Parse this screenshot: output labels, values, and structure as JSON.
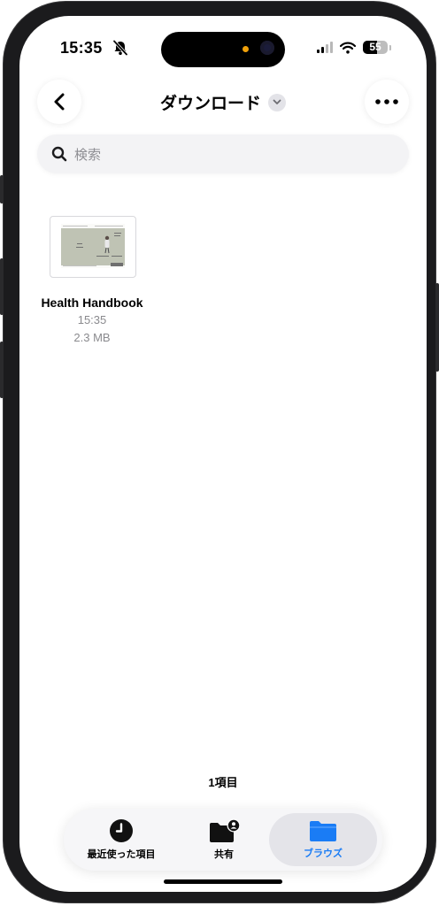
{
  "status_bar": {
    "time": "15:35",
    "battery": "55",
    "icons": [
      "bell-slash-icon",
      "signal-icon",
      "wifi-icon",
      "battery-icon"
    ]
  },
  "nav": {
    "back_icon": "chevron-left-icon",
    "title": "ダウンロード",
    "title_chevron_icon": "chevron-down-icon",
    "more_icon": "ellipsis-icon"
  },
  "search": {
    "placeholder": "検索",
    "icon": "search-icon"
  },
  "files": [
    {
      "name": "Health Handbook",
      "time": "15:35",
      "size": "2.3 MB",
      "icon": "pdf-thumbnail"
    }
  ],
  "item_count": "1項目",
  "tabs": [
    {
      "label": "最近使った項目",
      "icon": "clock-icon",
      "active": false
    },
    {
      "label": "共有",
      "icon": "shared-folder-icon",
      "active": false
    },
    {
      "label": "ブラウズ",
      "icon": "folder-icon",
      "active": true
    }
  ],
  "colors": {
    "accent": "#1a7cf5",
    "inactive_tab": "#000000",
    "secondary_text": "#8a8a8e",
    "background": "#ffffff"
  }
}
